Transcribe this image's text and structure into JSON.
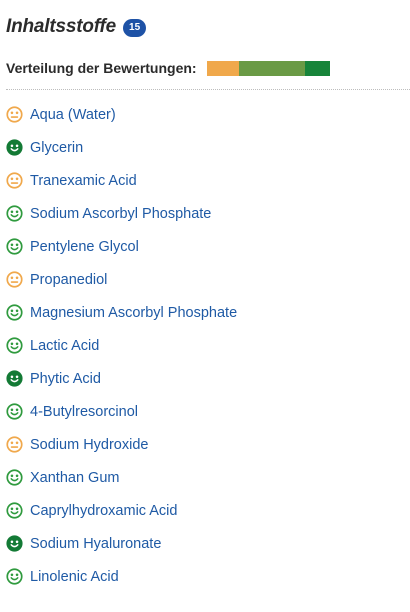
{
  "header": {
    "title": "Inhaltsstoffe",
    "count": "15"
  },
  "distribution": {
    "label": "Verteilung der Bewertungen:",
    "segments": [
      {
        "rating": "neutral",
        "color": "#f0a84b",
        "count": 4
      },
      {
        "rating": "good",
        "color": "#6a9a45",
        "count": 8
      },
      {
        "rating": "very-good",
        "color": "#17843a",
        "count": 3
      }
    ]
  },
  "ratings": {
    "neutral": {
      "icon": "neutral-face-icon",
      "color": "#f0a84b"
    },
    "good": {
      "icon": "smile-face-icon",
      "color": "#2f9a3e"
    },
    "very-good": {
      "icon": "grin-face-icon",
      "color": "#137a35"
    }
  },
  "ingredients": [
    {
      "name": "Aqua (Water)",
      "rating": "neutral"
    },
    {
      "name": "Glycerin",
      "rating": "very-good"
    },
    {
      "name": "Tranexamic Acid",
      "rating": "neutral"
    },
    {
      "name": "Sodium Ascorbyl Phosphate",
      "rating": "good"
    },
    {
      "name": "Pentylene Glycol",
      "rating": "good"
    },
    {
      "name": "Propanediol",
      "rating": "neutral"
    },
    {
      "name": "Magnesium Ascorbyl Phosphate",
      "rating": "good"
    },
    {
      "name": "Lactic Acid",
      "rating": "good"
    },
    {
      "name": "Phytic Acid",
      "rating": "very-good"
    },
    {
      "name": "4-Butylresorcinol",
      "rating": "good"
    },
    {
      "name": "Sodium Hydroxide",
      "rating": "neutral"
    },
    {
      "name": "Xanthan Gum",
      "rating": "good"
    },
    {
      "name": "Caprylhydroxamic Acid",
      "rating": "good"
    },
    {
      "name": "Sodium Hyaluronate",
      "rating": "very-good"
    },
    {
      "name": "Linolenic Acid",
      "rating": "good"
    }
  ]
}
